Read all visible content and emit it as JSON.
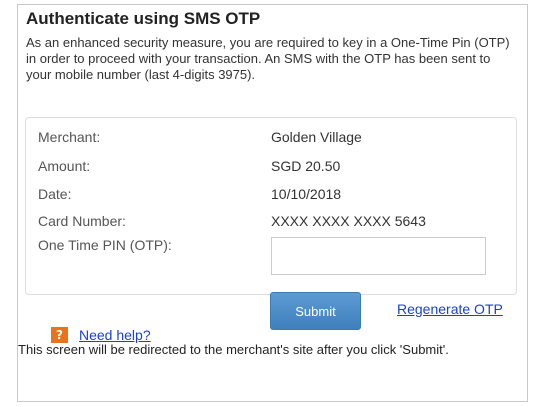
{
  "header": {
    "title": "Authenticate using SMS OTP"
  },
  "intro": {
    "text": "As an enhanced security measure, you are required to key in a One-Time Pin (OTP) in order to proceed with your transaction. An SMS with the OTP has been sent to your mobile number (last 4-digits 3975)."
  },
  "details": {
    "merchant_label": "Merchant:",
    "merchant_value": "Golden Village",
    "amount_label": "Amount:",
    "amount_value": "SGD 20.50",
    "date_label": "Date:",
    "date_value": "10/10/2018",
    "card_label": "Card Number:",
    "card_value": "XXXX XXXX XXXX 5643",
    "otp_label": "One Time PIN (OTP):",
    "otp_value": ""
  },
  "actions": {
    "submit_label": "Submit",
    "regenerate_label": "Regenerate OTP"
  },
  "help": {
    "icon_glyph": "?",
    "icon_name": "help-icon",
    "link_label": "Need help?"
  },
  "footer": {
    "note": "This screen will be redirected to the merchant's site after you click 'Submit'."
  },
  "colors": {
    "link": "#1a3fd6",
    "button": "#4a8ac6",
    "help_icon": "#e8731a"
  }
}
